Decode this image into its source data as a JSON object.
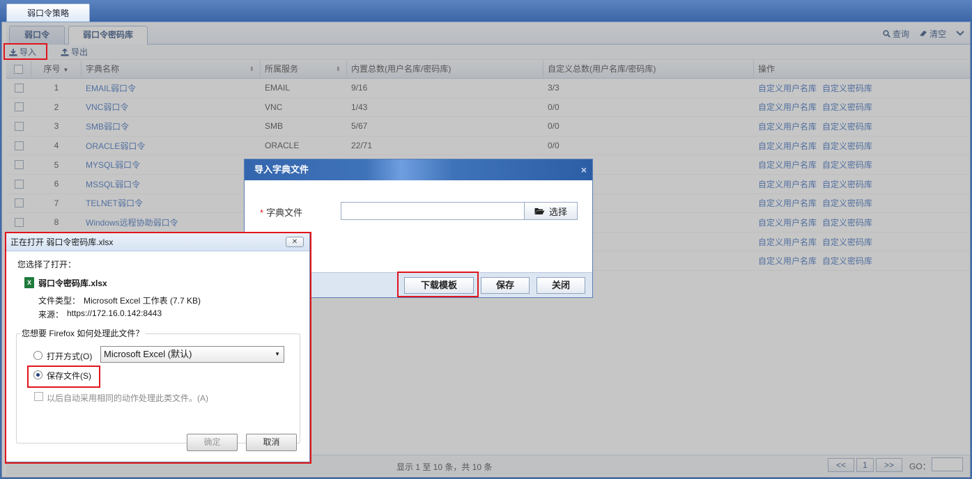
{
  "outer_tab": "弱口令策略",
  "inner_tabs": [
    "弱口令",
    "弱口令密码库"
  ],
  "top_actions": {
    "query": "查询",
    "clear": "清空"
  },
  "toolbar": {
    "import": "导入",
    "export": "导出"
  },
  "columns": [
    "序号",
    "字典名称",
    "所属服务",
    "内置总数(用户名库/密码库)",
    "自定义总数(用户名库/密码库)",
    "操作"
  ],
  "rows": [
    {
      "no": "1",
      "name": "EMAIL弱口令",
      "service": "EMAIL",
      "builtin": "9/16",
      "custom": "3/3"
    },
    {
      "no": "2",
      "name": "VNC弱口令",
      "service": "VNC",
      "builtin": "1/43",
      "custom": "0/0"
    },
    {
      "no": "3",
      "name": "SMB弱口令",
      "service": "SMB",
      "builtin": "5/67",
      "custom": "0/0"
    },
    {
      "no": "4",
      "name": "ORACLE弱口令",
      "service": "ORACLE",
      "builtin": "22/71",
      "custom": "0/0"
    },
    {
      "no": "5",
      "name": "MYSQL弱口令",
      "service": "",
      "builtin": "",
      "custom": ""
    },
    {
      "no": "6",
      "name": "MSSQL弱口令",
      "service": "",
      "builtin": "",
      "custom": ""
    },
    {
      "no": "7",
      "name": "TELNET弱口令",
      "service": "",
      "builtin": "",
      "custom": ""
    },
    {
      "no": "8",
      "name": "Windows远程协助弱口令",
      "service": "",
      "builtin": "",
      "custom": ""
    },
    {
      "no": "",
      "name": "",
      "service": "",
      "builtin": "",
      "custom": ""
    },
    {
      "no": "",
      "name": "",
      "service": "",
      "builtin": "",
      "custom": ""
    }
  ],
  "action_links": [
    "自定义用户名库",
    "自定义密码库"
  ],
  "pager": {
    "info": "显示 1 至 10 条，共 10 条",
    "prev": "<<",
    "page": "1",
    "next": ">>",
    "go": "GO："
  },
  "import_modal": {
    "title": "导入字典文件",
    "close": "×",
    "field_label": "字典文件",
    "required_mark": "*",
    "choose": "选择",
    "download_template": "下载模板",
    "save": "保存",
    "close_btn": "关闭"
  },
  "firefox_dialog": {
    "title": "正在打开 弱口令密码库.xlsx",
    "close": "✕",
    "chosen": "您选择了打开：",
    "filename": "弱口令密码库.xlsx",
    "type_label": "文件类型：",
    "type_value": "Microsoft Excel 工作表 (7.7 KB)",
    "source_label": "来源：",
    "source_value": "https://172.16.0.142:8443",
    "question": "您想要 Firefox 如何处理此文件？",
    "open_with": "打开方式(O)",
    "open_with_app": "Microsoft Excel (默认)",
    "save_file": "保存文件(S)",
    "auto": "以后自动采用相同的动作处理此类文件。(A)",
    "ok": "确定",
    "cancel": "取消"
  },
  "colors": {
    "accent": "#2a62b8",
    "highlight_border": "#e0141c",
    "header_blue": "#3466ad"
  }
}
